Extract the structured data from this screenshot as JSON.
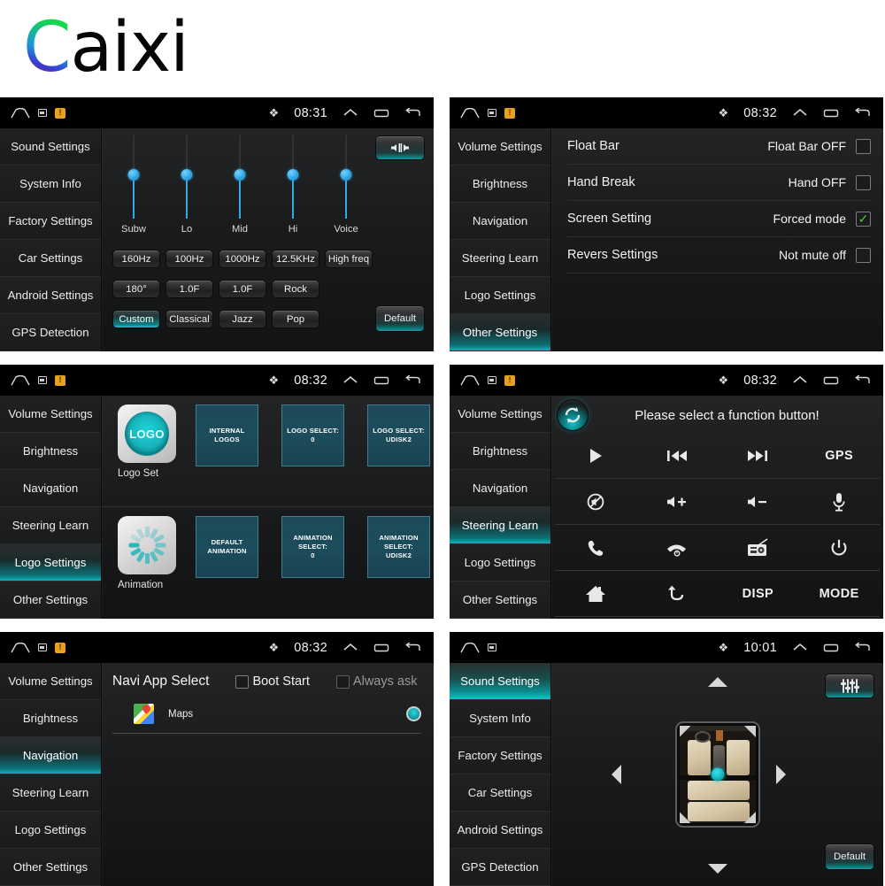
{
  "brand": {
    "initial": "C",
    "rest": "aixi"
  },
  "panels": [
    {
      "id": "sound-settings",
      "statusbar": {
        "time": "08:31",
        "bluetooth": "bluetooth-icon",
        "home": "home-icon",
        "screenshot": "screenshot-icon",
        "warning": "warning-icon",
        "up": "collapse-icon",
        "recents": "recents-icon",
        "back": "back-icon"
      },
      "sidebar": {
        "items": [
          {
            "label": "Sound Settings",
            "selected": false
          },
          {
            "label": "System Info",
            "selected": false
          },
          {
            "label": "Factory Settings",
            "selected": false
          },
          {
            "label": "Car Settings",
            "selected": false
          },
          {
            "label": "Android Settings",
            "selected": false
          },
          {
            "label": "GPS Detection",
            "selected": false
          }
        ]
      },
      "equalizer": {
        "bands": [
          {
            "label": "Subw"
          },
          {
            "label": "Lo"
          },
          {
            "label": "Mid"
          },
          {
            "label": "Hi"
          },
          {
            "label": "Voice"
          }
        ],
        "row1": [
          {
            "label": "160Hz",
            "active": false
          },
          {
            "label": "100Hz",
            "active": false
          },
          {
            "label": "1000Hz",
            "active": false
          },
          {
            "label": "12.5KHz",
            "active": false
          },
          {
            "label": "High freq",
            "active": false
          }
        ],
        "row2": [
          {
            "label": "180°",
            "active": false
          },
          {
            "label": "1.0F",
            "active": false
          },
          {
            "label": "1.0F",
            "active": false
          },
          {
            "label": "Rock",
            "active": false
          }
        ],
        "row3": [
          {
            "label": "Custom",
            "active": true
          },
          {
            "label": "Classical",
            "active": false
          },
          {
            "label": "Jazz",
            "active": false
          },
          {
            "label": "Pop",
            "active": false
          }
        ],
        "balance_button": "balance-speaker-icon",
        "default_label": "Default"
      }
    },
    {
      "id": "other-settings",
      "statusbar": {
        "time": "08:32"
      },
      "sidebar": {
        "items": [
          {
            "label": "Volume Settings",
            "selected": false
          },
          {
            "label": "Brightness",
            "selected": false
          },
          {
            "label": "Navigation",
            "selected": false
          },
          {
            "label": "Steering Learn",
            "selected": false
          },
          {
            "label": "Logo Settings",
            "selected": false
          },
          {
            "label": "Other Settings",
            "selected": true
          }
        ]
      },
      "rows": [
        {
          "name": "Float Bar",
          "value": "Float Bar OFF",
          "checked": false
        },
        {
          "name": "Hand Break",
          "value": "Hand OFF",
          "checked": false
        },
        {
          "name": "Screen Setting",
          "value": "Forced mode",
          "checked": true
        },
        {
          "name": "Revers Settings",
          "value": "Not mute off",
          "checked": false
        }
      ],
      "check_glyph": "✓"
    },
    {
      "id": "logo-settings",
      "statusbar": {
        "time": "08:32"
      },
      "sidebar": {
        "items": [
          {
            "label": "Volume Settings",
            "selected": false
          },
          {
            "label": "Brightness",
            "selected": false
          },
          {
            "label": "Navigation",
            "selected": false
          },
          {
            "label": "Steering Learn",
            "selected": false
          },
          {
            "label": "Logo Settings",
            "selected": true
          },
          {
            "label": "Other Settings",
            "selected": false
          }
        ]
      },
      "sections": [
        {
          "thumb_text": "LOGO",
          "caption": "Logo Set",
          "tiles": [
            "INTERNAL LOGOS",
            "LOGO SELECT:\n0",
            "LOGO SELECT:\nUDISK2"
          ]
        },
        {
          "thumb_text": "",
          "caption": "Animation",
          "tiles": [
            "DEFAULT\nANIMATION",
            "ANIMATION\nSELECT:\n0",
            "ANIMATION\nSELECT:\nUDISK2"
          ]
        }
      ]
    },
    {
      "id": "steering-learn",
      "statusbar": {
        "time": "08:32"
      },
      "sidebar": {
        "items": [
          {
            "label": "Volume Settings",
            "selected": false
          },
          {
            "label": "Brightness",
            "selected": false
          },
          {
            "label": "Navigation",
            "selected": false
          },
          {
            "label": "Steering Learn",
            "selected": true
          },
          {
            "label": "Logo Settings",
            "selected": false
          },
          {
            "label": "Other Settings",
            "selected": false
          }
        ]
      },
      "title": "Please select a function button!",
      "refresh_icon": "refresh-icon",
      "buttons": [
        {
          "icon": "play-icon",
          "label": ""
        },
        {
          "icon": "previous-track-icon",
          "label": ""
        },
        {
          "icon": "next-track-icon",
          "label": ""
        },
        {
          "icon": "gps-label",
          "label": "GPS"
        },
        {
          "icon": "mute-icon",
          "label": ""
        },
        {
          "icon": "volume-up-icon",
          "label": ""
        },
        {
          "icon": "volume-down-icon",
          "label": ""
        },
        {
          "icon": "microphone-icon",
          "label": ""
        },
        {
          "icon": "phone-answer-icon",
          "label": ""
        },
        {
          "icon": "phone-hangup-icon",
          "label": ""
        },
        {
          "icon": "radio-icon",
          "label": ""
        },
        {
          "icon": "power-icon",
          "label": ""
        },
        {
          "icon": "home-icon",
          "label": ""
        },
        {
          "icon": "back-icon",
          "label": ""
        },
        {
          "icon": "disp-label",
          "label": "DISP"
        },
        {
          "icon": "mode-label",
          "label": "MODE"
        }
      ]
    },
    {
      "id": "navigation",
      "statusbar": {
        "time": "08:32"
      },
      "sidebar": {
        "items": [
          {
            "label": "Volume Settings",
            "selected": false
          },
          {
            "label": "Brightness",
            "selected": false
          },
          {
            "label": "Navigation",
            "selected": true
          },
          {
            "label": "Steering Learn",
            "selected": false
          },
          {
            "label": "Logo Settings",
            "selected": false
          },
          {
            "label": "Other Settings",
            "selected": false
          }
        ]
      },
      "title": "Navi App Select",
      "checks": [
        {
          "label": "Boot Start",
          "checked": false,
          "dim": false
        },
        {
          "label": "Always ask",
          "checked": false,
          "dim": true
        }
      ],
      "apps": [
        {
          "name": "Maps",
          "icon": "google-maps-icon",
          "selected": true
        }
      ]
    },
    {
      "id": "car-settings-fader",
      "statusbar": {
        "time": "10:01"
      },
      "sidebar": {
        "items": [
          {
            "label": "Sound Settings",
            "selected": true
          },
          {
            "label": "System Info",
            "selected": false
          },
          {
            "label": "Factory Settings",
            "selected": false
          },
          {
            "label": "Car Settings",
            "selected": false
          },
          {
            "label": "Android Settings",
            "selected": false
          },
          {
            "label": "GPS Detection",
            "selected": false
          }
        ]
      },
      "eq_button": "equalizer-icon",
      "default_label": "Default",
      "arrows": [
        "up-arrow",
        "down-arrow",
        "left-arrow",
        "right-arrow"
      ],
      "fader_handle": "fader-position-handle"
    }
  ]
}
